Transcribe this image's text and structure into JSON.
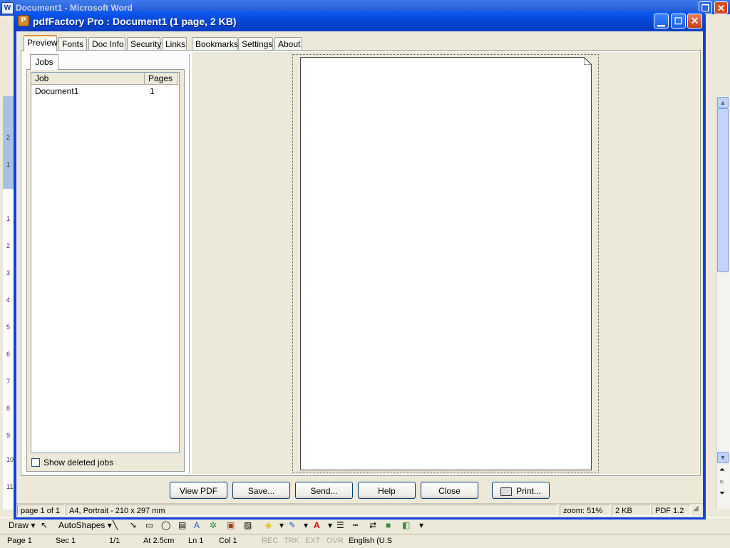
{
  "background_window": {
    "title": "Document1 - Microsoft Word",
    "draw_toolbar": {
      "draw_label": "Draw",
      "autoshapes_label": "AutoShapes"
    },
    "ruler_numbers": [
      "2",
      "1",
      "1",
      "2",
      "3",
      "4",
      "5",
      "6",
      "7",
      "8",
      "9",
      "10",
      "11"
    ],
    "status": {
      "page": "Page 1",
      "section": "Sec 1",
      "pages": "1/1",
      "at": "At 2.5cm",
      "line": "Ln 1",
      "col": "Col 1",
      "rec": "REC",
      "trk": "TRK",
      "ext": "EXT",
      "ovr": "OVR",
      "language": "English (U.S"
    }
  },
  "dialog": {
    "title": "pdfFactory Pro : Document1 (1 page, 2 KB)",
    "tabs": [
      "Preview",
      "Fonts",
      "Doc Info",
      "Security",
      "Links",
      "Bookmarks",
      "Settings",
      "About"
    ],
    "active_tab": "Preview",
    "jobs": {
      "tab_label": "Jobs",
      "columns": [
        "Job",
        "Pages"
      ],
      "rows": [
        {
          "job": "Document1",
          "pages": "1"
        }
      ],
      "show_deleted_label": "Show deleted jobs",
      "show_deleted_checked": false
    },
    "buttons": {
      "view_pdf": "View PDF",
      "save": "Save...",
      "send": "Send...",
      "help": "Help",
      "close": "Close",
      "print": "Print..."
    },
    "status": {
      "page_info": "page 1 of 1",
      "paper": "A4, Portrait - 210 x 297 mm",
      "zoom": "zoom: 51%",
      "size": "2 KB",
      "pdf_version": "PDF 1.2"
    }
  }
}
